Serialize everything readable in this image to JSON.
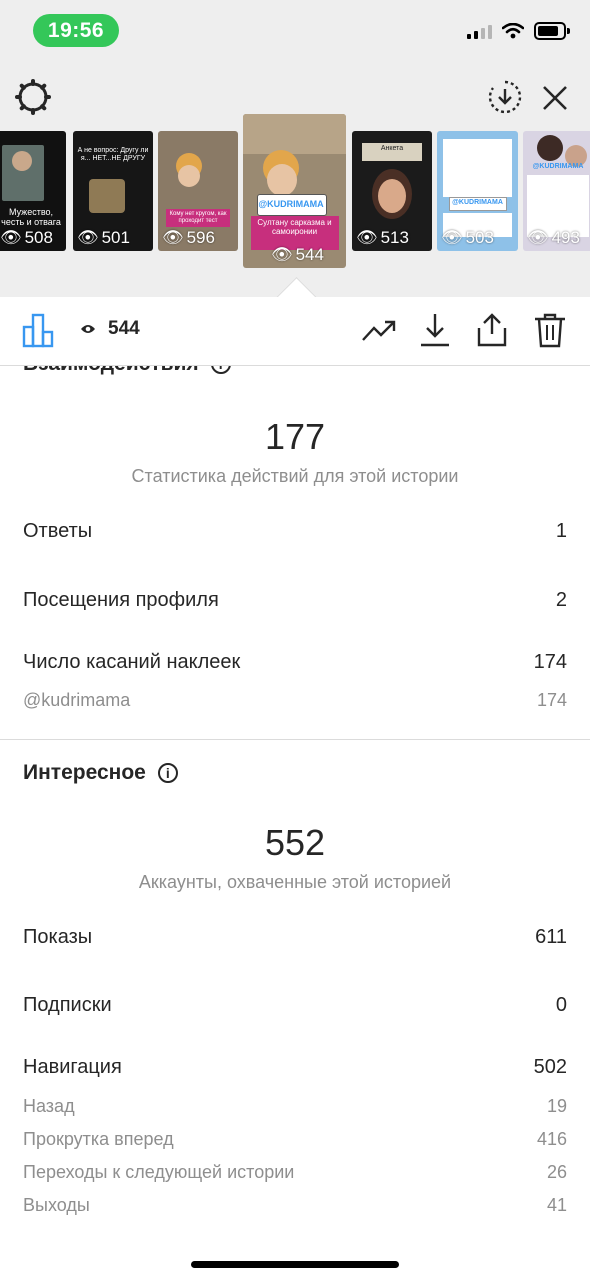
{
  "status_bar": {
    "time": "19:56",
    "accent": "#34c759"
  },
  "header": {
    "settings_icon": "gear-icon",
    "download_story_icon": "circle-download-icon",
    "close_icon": "close-icon"
  },
  "thumbnails": [
    {
      "views": "508",
      "caption": "Мужество, честь и отвага",
      "bg": "#111111"
    },
    {
      "views": "501",
      "caption": "А не вопрос: Другу ли я... НЕТ...НЕ ДРУГУ",
      "bg": "#161616"
    },
    {
      "views": "596",
      "caption": "Кому нет кругом, как проходит тест",
      "bg": "#8a7a66"
    },
    {
      "views": "544",
      "caption": "Султану сарказма и самоиронии",
      "brand": "@KUDRIMAMA",
      "bg": "#9a8a72"
    },
    {
      "views": "513",
      "caption": "Анкета",
      "bg": "#1b1b1b"
    },
    {
      "views": "503",
      "caption": "@KUDRIMAMA",
      "bg": "#8ec1e8"
    },
    {
      "views": "493",
      "caption": "@KUDRIMAMA",
      "bg": "#d9d4e3"
    }
  ],
  "action_bar": {
    "insights_icon": "bar-chart-icon",
    "views_icon": "eye-icon",
    "views": "544",
    "promote_icon": "trend-arrow-icon",
    "save_icon": "download-icon",
    "share_icon": "share-icon",
    "delete_icon": "trash-icon",
    "accent": "#3897f0"
  },
  "interactions": {
    "title": "Взаимодействия",
    "total": "177",
    "caption": "Статистика действий для этой истории",
    "rows": [
      {
        "label": "Ответы",
        "value": "1"
      },
      {
        "label": "Посещения профиля",
        "value": "2"
      },
      {
        "label": "Число касаний наклеек",
        "value": "174"
      }
    ],
    "sub_rows": [
      {
        "label": "@kudrimama",
        "value": "174"
      }
    ]
  },
  "discovery": {
    "title": "Интересное",
    "total": "552",
    "caption": "Аккаунты, охваченные этой историей",
    "rows": [
      {
        "label": "Показы",
        "value": "611"
      },
      {
        "label": "Подписки",
        "value": "0"
      },
      {
        "label": "Навигация",
        "value": "502"
      }
    ],
    "sub_rows": [
      {
        "label": "Назад",
        "value": "19"
      },
      {
        "label": "Прокрутка вперед",
        "value": "416"
      },
      {
        "label": "Переходы к следующей истории",
        "value": "26"
      },
      {
        "label": "Выходы",
        "value": "41"
      }
    ]
  }
}
